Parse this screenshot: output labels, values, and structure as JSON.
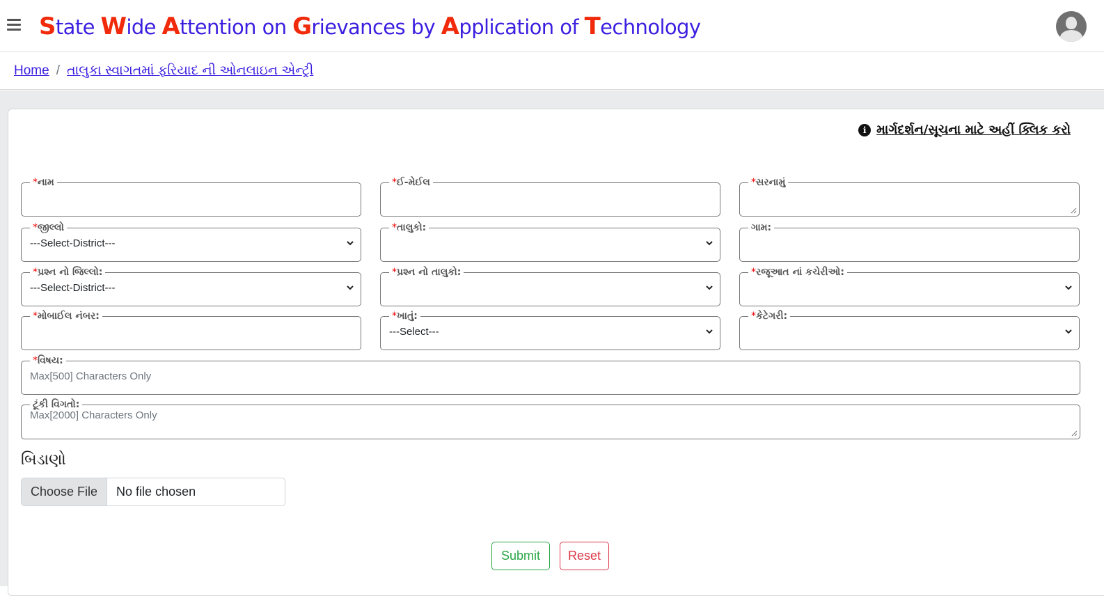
{
  "header": {
    "title_parts": [
      {
        "cap": "S",
        "rest": "tate "
      },
      {
        "cap": "W",
        "rest": "ide "
      },
      {
        "cap": "A",
        "rest": "ttention on "
      },
      {
        "cap": "G",
        "rest": "rievances by "
      },
      {
        "cap": "A",
        "rest": "pplication of "
      },
      {
        "cap": "T",
        "rest": "echnology"
      }
    ],
    "menu_icon": "hamburger-icon",
    "avatar_icon": "user-avatar-icon",
    "colors": {
      "title": "#3b1fe0",
      "capital": "#f02a0a"
    }
  },
  "breadcrumb": {
    "home": "Home",
    "separator": "/",
    "current": "તાલુકા સ્વાગતમાં ફરિયાદ ની ઓનલાઇન એન્ટ્રી"
  },
  "help_link": {
    "icon": "info-icon",
    "icon_glyph": "i",
    "label": "માર્ગદર્શન/સૂચના માટે અહીં ક્લિક કરો"
  },
  "form": {
    "required_mark": "*",
    "fields": {
      "name": {
        "label": "નામ",
        "required": true,
        "value": ""
      },
      "email": {
        "label": "ઈ-મેઈલ",
        "required": true,
        "value": ""
      },
      "address": {
        "label": "સરનામું",
        "required": true,
        "value": ""
      },
      "district": {
        "label": "જીલ્લો",
        "required": true,
        "selected": "---Select-District---"
      },
      "taluka": {
        "label": "તાલુકો:",
        "required": true,
        "selected": ""
      },
      "village": {
        "label": "ગામ:",
        "required": false,
        "value": ""
      },
      "q_district": {
        "label": "પ્રશ્ન નો જિલ્લો:",
        "required": true,
        "selected": "---Select-District---"
      },
      "q_taluka": {
        "label": "પ્રશ્ન નો તાલુકો:",
        "required": true,
        "selected": ""
      },
      "office": {
        "label": "રજૂઆત નાં કચેરીઓ:",
        "required": true,
        "selected": ""
      },
      "mobile": {
        "label": "મોબાઈલ નંબર:",
        "required": true,
        "value": ""
      },
      "department": {
        "label": "ખાતું:",
        "required": true,
        "selected": "---Select---"
      },
      "category": {
        "label": "કેટેગરી:",
        "required": true,
        "selected": ""
      },
      "subject": {
        "label": "વિષય:",
        "required": true,
        "placeholder": "Max[500] Characters Only"
      },
      "details": {
        "label": "ટૂંકી વિગતો:",
        "required": false,
        "placeholder": "Max[2000] Characters Only"
      }
    },
    "attachment": {
      "label": "બિડાણો",
      "button": "Choose File",
      "status": "No file chosen"
    },
    "buttons": {
      "submit": "Submit",
      "reset": "Reset"
    }
  }
}
